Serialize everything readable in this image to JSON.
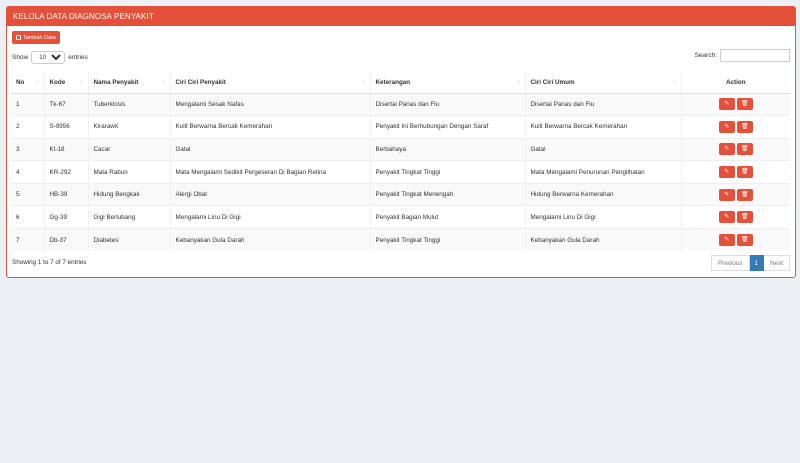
{
  "panel": {
    "title": "KELOLA DATA DIAGNOSA PENYAKIT"
  },
  "toolbar": {
    "add_label": "Tambah Data"
  },
  "length": {
    "show": "Show",
    "value": "10",
    "entries": "entries"
  },
  "search": {
    "label": "Search:",
    "value": "",
    "placeholder": ""
  },
  "table": {
    "headers": [
      "No",
      "Kode",
      "Nama Penyakit",
      "Ciri Ciri Penyakit",
      "Keterangan",
      "Ciri Ciri Umum",
      "Action"
    ],
    "rows": [
      [
        "1",
        "Tk-67",
        "Tuberklosis",
        "Mengalami Sesak Nafas",
        "Disertai Panas dan Flu",
        "Disertai Panas dan Flu"
      ],
      [
        "2",
        "S-9956",
        "Kirarawit",
        "Kulit Berwarna Bercak Kemerahan",
        "Penyakit Ini Berhubungan Dengan Saraf",
        "Kulit Berwarna Bercak Kemerahan"
      ],
      [
        "3",
        "Kt-18",
        "Cacar",
        "Gatal",
        "Berbahaya",
        "Gatal"
      ],
      [
        "4",
        "KR-292",
        "Mata Rabun",
        "Mata Mengalami Sedikit Pergeseran Di Bagian Retina",
        "Penyakit Tingkat Tinggi",
        "Mata Mengalami Penurunan Penglihatan"
      ],
      [
        "5",
        "HB-39",
        "Hidung Bengkak",
        "Alergi Obat",
        "Penyakit Tingkat Menengah",
        "Hidung Berwarna Kemerahan"
      ],
      [
        "6",
        "Gg-39",
        "Gigi Berlubang",
        "Mengalami Linu Di Gigi",
        "Penyakit Bagian Mulut",
        "Mengalami Linu Di Gigi"
      ],
      [
        "7",
        "Db-37",
        "Diabetes",
        "Kebanyakan Gula Darah",
        "Penyakit Tingkat Tinggi",
        "Kebanyakan Gula Darah"
      ]
    ]
  },
  "footer": {
    "info": "Showing 1 to 7 of 7 entries",
    "prev": "Previous",
    "page": "1",
    "next": "Next"
  },
  "colors": {
    "accent": "#e4503a",
    "page_active": "#337ab7",
    "background": "#ecf0f5"
  },
  "icons": {
    "add": "add-doc-icon",
    "edit": "edit-icon",
    "delete": "trash-icon",
    "sort": "sort-icon"
  }
}
